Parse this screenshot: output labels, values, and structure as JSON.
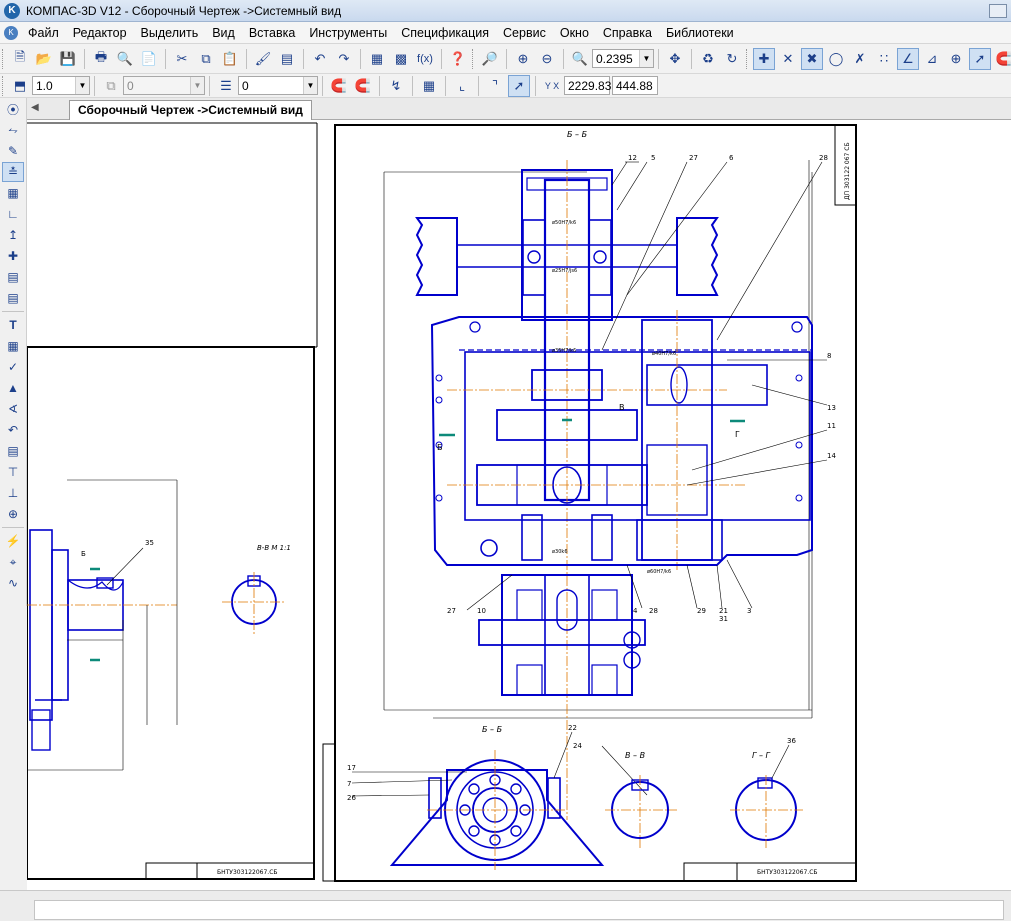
{
  "window": {
    "title": "КОМПАС-3D V12 - Сборочный Чертеж ->Системный вид",
    "logo_text": "K"
  },
  "menu": {
    "items": [
      "Файл",
      "Редактор",
      "Выделить",
      "Вид",
      "Вставка",
      "Инструменты",
      "Спецификация",
      "Сервис",
      "Окно",
      "Справка",
      "Библиотеки"
    ]
  },
  "toolbar": {
    "zoom_value": "0.2395",
    "line_scale": "1.0",
    "layer_value": "0",
    "style_value": "0",
    "coord_x": "2229.83",
    "coord_y": "444.88"
  },
  "document": {
    "tab_label": "Сборочный Чертеж ->Системный вид"
  },
  "drawing": {
    "section_bb_top": "Б – Б",
    "section_bb_bottom": "Б – Б",
    "section_vv": "В – В",
    "section_gg": "Г – Г",
    "section_vv_left": "В-В  М 1:1",
    "view_b": "Б",
    "view_v": "В",
    "view_g": "Г",
    "stamp_number_right": "БНТУ303122067.СБ",
    "stamp_number_left": "БНТУ303122067.СБ",
    "frame_code": "ДП 303122 067 СБ",
    "callouts_top": [
      "12",
      "5",
      "27",
      "6",
      "28"
    ],
    "callouts_right": [
      "8",
      "13",
      "11",
      "14"
    ],
    "callouts_bottom_main": [
      "27",
      "10",
      "4",
      "28",
      "29",
      "21",
      "3",
      "31"
    ],
    "callouts_section": [
      "17",
      "7",
      "26",
      "22",
      "24",
      "36",
      "35"
    ],
    "fits": [
      "ø50H7/k6",
      "ø25H7/js6",
      "ø35H7/k6",
      "ø40H7/k6",
      "ø30k6",
      "ø60H7/k6"
    ]
  },
  "colors": {
    "part_lines": "#0000cc",
    "center_lines": "#e07700",
    "frame": "#000000",
    "hatch": "#0000cc"
  }
}
